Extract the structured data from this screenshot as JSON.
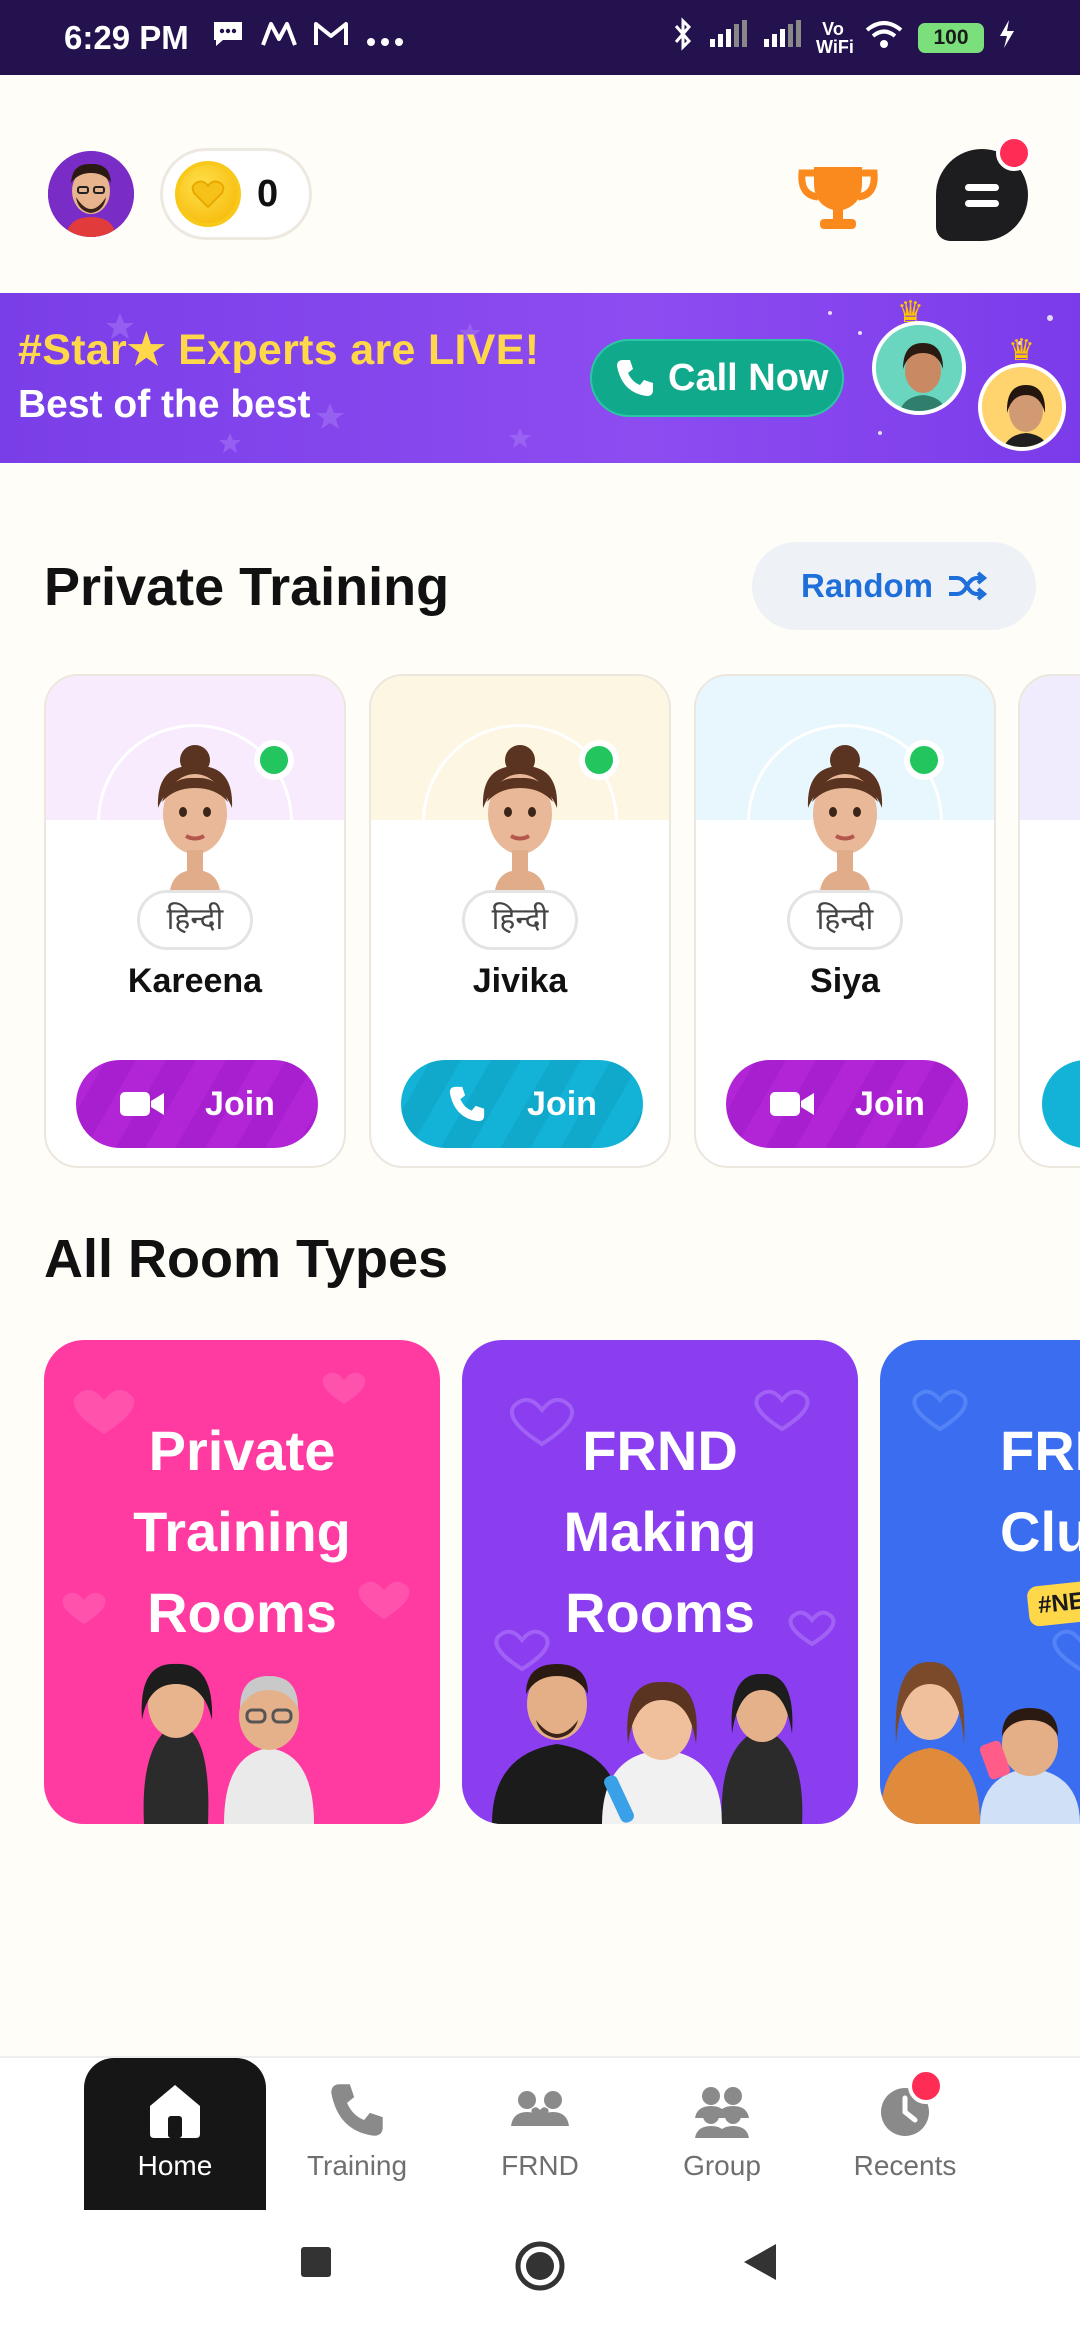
{
  "status_bar": {
    "time": "6:29 PM",
    "icons": [
      "message-icon",
      "m-logo-icon",
      "gmail-icon",
      "more-dots-icon"
    ],
    "right_icons": [
      "bluetooth-icon",
      "signal-icon",
      "signal-icon",
      "vowifi-icon",
      "wifi-icon"
    ],
    "vowifi": "Vo WiFi",
    "battery": "100"
  },
  "header": {
    "coins": "0"
  },
  "banner": {
    "line1": "#Star★ Experts are LIVE!",
    "line2": "Best of the best",
    "call_label": "Call Now"
  },
  "private_training": {
    "title": "Private Training",
    "random_label": "Random",
    "cards": [
      {
        "name": "Kareena",
        "language": "हिन्दी",
        "join_label": "Join",
        "mode": "video",
        "top_color": "#f7ebfd"
      },
      {
        "name": "Jivika",
        "language": "हिन्दी",
        "join_label": "Join",
        "mode": "call",
        "top_color": "#fdf6e3"
      },
      {
        "name": "Siya",
        "language": "हिन्दी",
        "join_label": "Join",
        "mode": "video",
        "top_color": "#e8f6fd"
      }
    ]
  },
  "room_types": {
    "title": "All Room Types",
    "rooms": [
      {
        "lines": [
          "Private",
          "Training",
          "Rooms"
        ]
      },
      {
        "lines": [
          "FRND",
          "Making",
          "Rooms"
        ]
      },
      {
        "lines": [
          "FRI",
          "Clu"
        ],
        "tag": "#NE"
      }
    ]
  },
  "bottom_nav": {
    "items": [
      {
        "label": "Home",
        "icon": "home-icon"
      },
      {
        "label": "Training",
        "icon": "phone-icon"
      },
      {
        "label": "FRND",
        "icon": "friends-icon"
      },
      {
        "label": "Group",
        "icon": "group-icon"
      },
      {
        "label": "Recents",
        "icon": "clock-icon"
      }
    ]
  },
  "colors": {
    "status_bar": "#23124e",
    "banner": "#8d4cf0",
    "accent_blue": "#1e6fd9",
    "join_video": "#b125d6",
    "join_call": "#12b3d6",
    "online": "#22c55e",
    "badge": "#ff2d55"
  }
}
